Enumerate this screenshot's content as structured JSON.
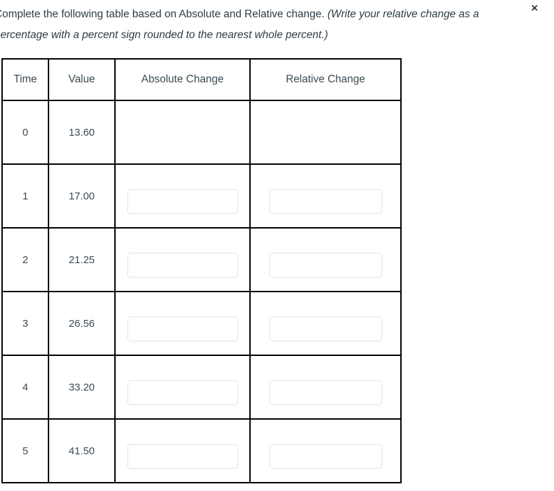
{
  "prompt": {
    "part1": "Complete the following table based on Absolute and Relative change. ",
    "part2": "(Write your relative change as a",
    "line2": "percentage with a percent sign rounded to the nearest whole percent.)"
  },
  "close_icon": {
    "glyph": "×",
    "name": "close-icon"
  },
  "table": {
    "headers": [
      "Time",
      "Value",
      "Absolute Change",
      "Relative Change"
    ],
    "rows": [
      {
        "time": "0",
        "value": "13.60",
        "absolute_change": "",
        "relative_change": "",
        "blacked_out": true
      },
      {
        "time": "1",
        "value": "17.00",
        "absolute_change": "",
        "relative_change": "",
        "blacked_out": false
      },
      {
        "time": "2",
        "value": "21.25",
        "absolute_change": "",
        "relative_change": "",
        "blacked_out": false
      },
      {
        "time": "3",
        "value": "26.56",
        "absolute_change": "",
        "relative_change": "",
        "blacked_out": false
      },
      {
        "time": "4",
        "value": "33.20",
        "absolute_change": "",
        "relative_change": "",
        "blacked_out": false
      },
      {
        "time": "5",
        "value": "41.50",
        "absolute_change": "",
        "relative_change": "",
        "blacked_out": false
      }
    ]
  },
  "colors": {
    "text": "#2d3b45",
    "table_border": "#000000",
    "input_border": "#e1e3e5",
    "blacked_cell": "#000000",
    "background": "#ffffff"
  }
}
